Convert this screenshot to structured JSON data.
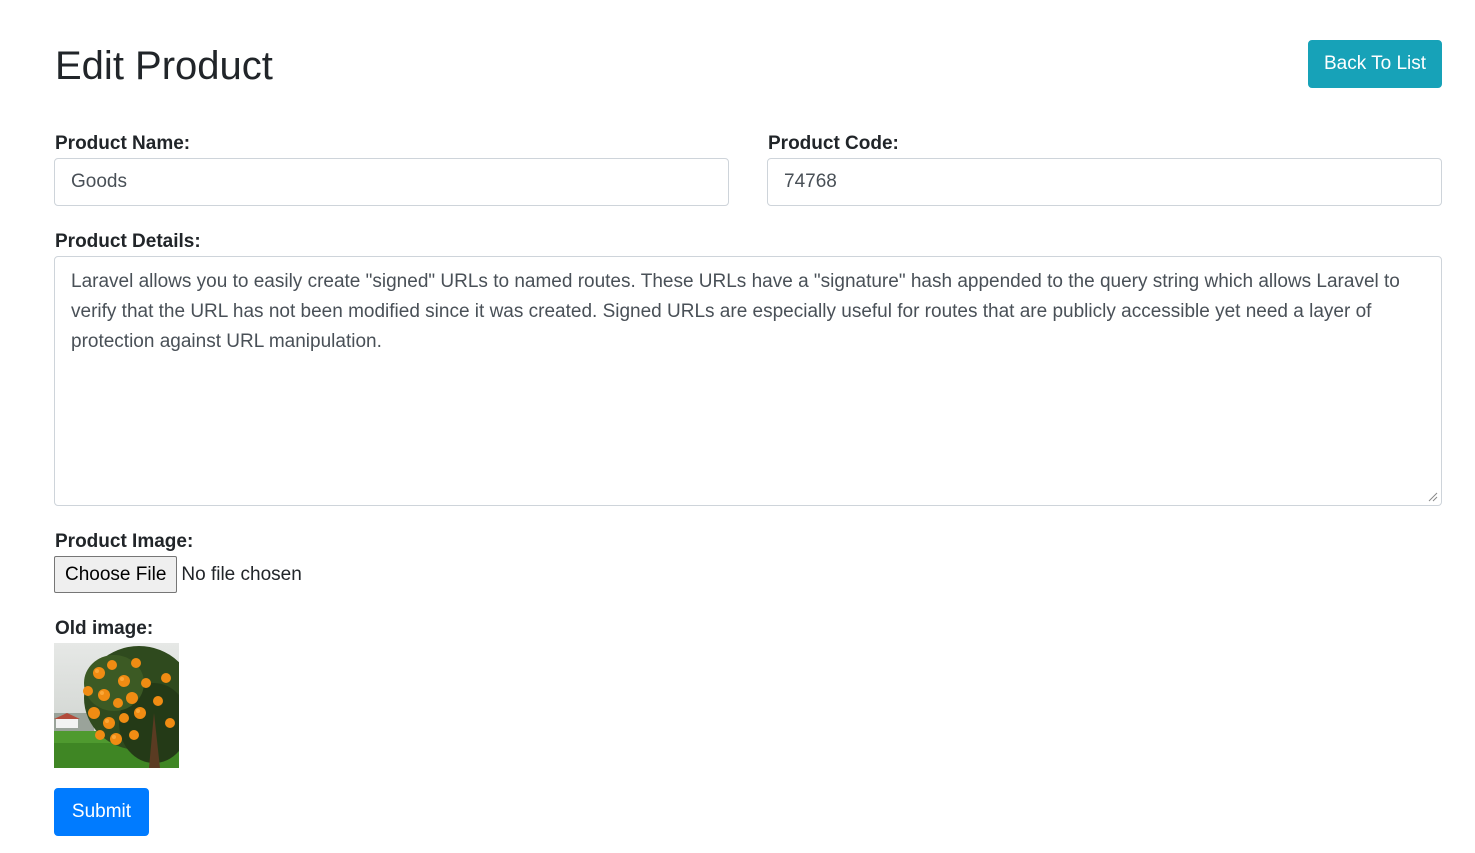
{
  "header": {
    "title": "Edit Product",
    "back_label": "Back To List"
  },
  "form": {
    "name_label": "Product Name:",
    "name_value": "Goods",
    "code_label": "Product Code:",
    "code_value": "74768",
    "details_label": "Product Details:",
    "details_value": "Laravel allows you to easily create \"signed\" URLs to named routes. These URLs have a \"signature\" hash appended to the query string which allows Laravel to verify that the URL has not been modified since it was created. Signed URLs are especially useful for routes that are publicly accessible yet need a layer of protection against URL manipulation.",
    "image_label": "Product Image:",
    "file_button_label": "Choose File",
    "file_status": "No file chosen",
    "old_image_label": "Old image:",
    "submit_label": "Submit"
  },
  "colors": {
    "info": "#17a2b8",
    "primary": "#007bff",
    "border": "#ced4da"
  }
}
